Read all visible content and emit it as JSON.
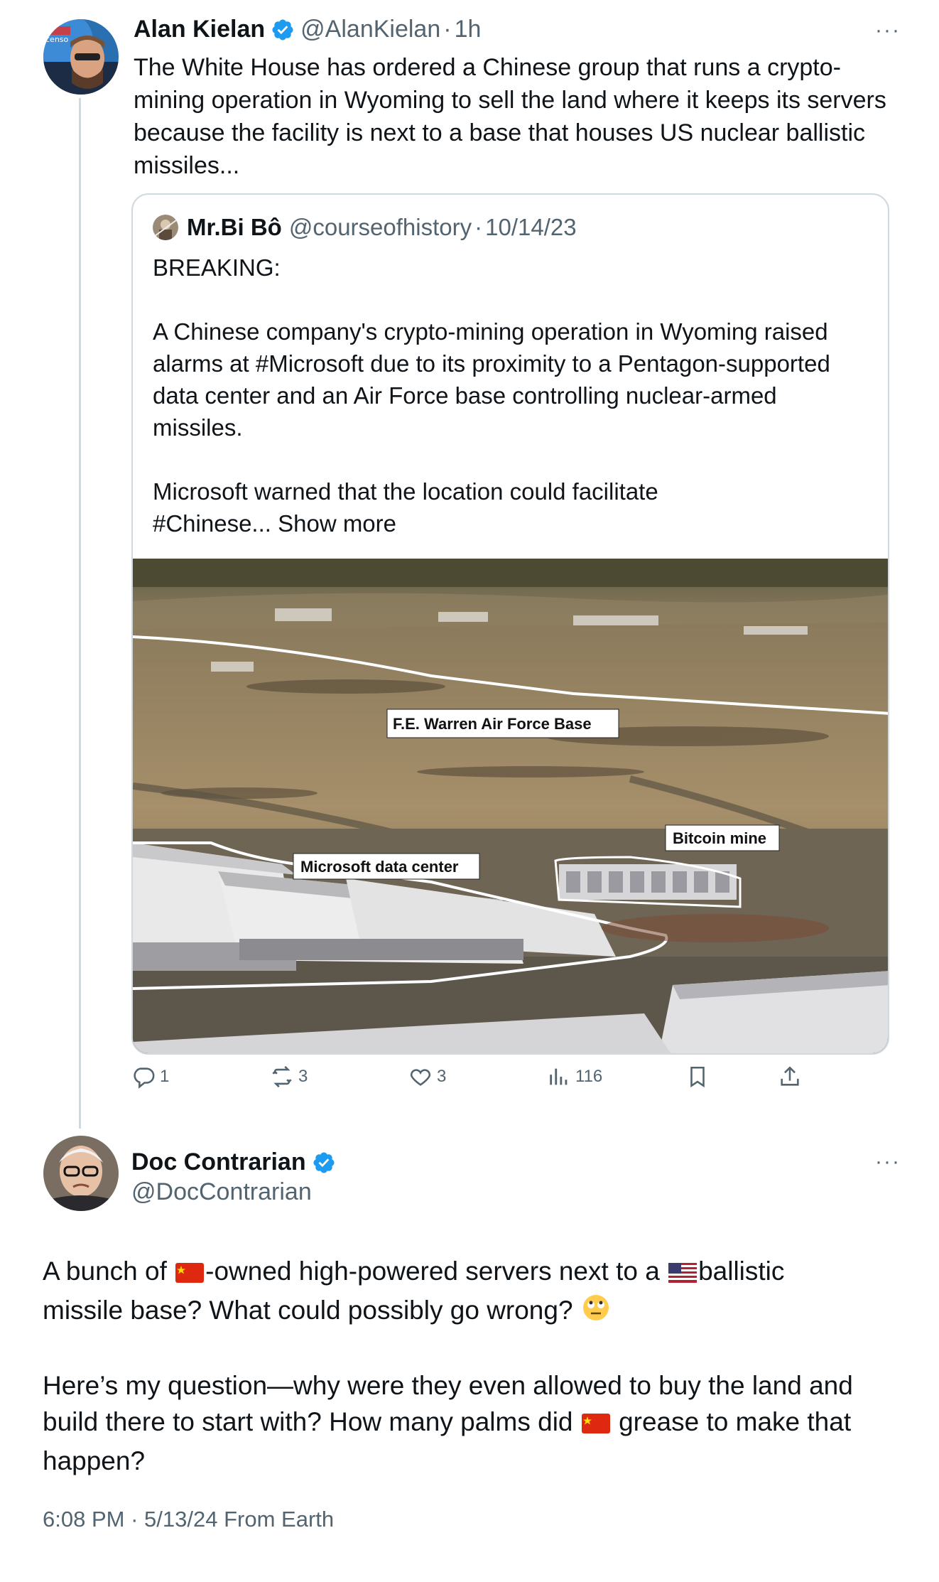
{
  "reply_parent": {
    "display_name": "Alan Kielan",
    "handle": "@AlanKielan",
    "separator": "·",
    "time": "1h",
    "text": "The White House has ordered a Chinese group that runs a crypto-\nmining operation in Wyoming to sell the land where it keeps its servers\nbecause the facility is next to a base that houses US nuclear ballistic\nmissiles...",
    "avatar_text": "censo"
  },
  "quote": {
    "display_name": "Mr.Bi Bô",
    "handle": "@courseofhistory",
    "separator": "·",
    "date": "10/14/23",
    "text": "BREAKING:\n\nA Chinese company's crypto-mining operation in Wyoming raised\nalarms at #Microsoft  due to its proximity to a Pentagon-supported\ndata center and an Air Force base controlling nuclear-armed\nmissiles.\n\nMicrosoft warned that the location could facilitate\n#Chinese...",
    "show_more": " Show more",
    "media_labels": {
      "air_force_base": "F.E. Warren Air Force Base",
      "bitcoin_mine": "Bitcoin mine",
      "data_center": "Microsoft data center"
    }
  },
  "actions": {
    "replies": "1",
    "reposts": "3",
    "likes": "3",
    "views": "116"
  },
  "main_post": {
    "display_name": "Doc Contrarian",
    "handle": "@DocContrarian",
    "text_1a": "A bunch of ",
    "text_1b": "-owned high-powered servers next to a ",
    "text_1c": "ballistic\nmissile base? What could possibly go wrong? ",
    "text_2a": "\n\nHere’s my question—why were they even allowed to buy the land and\nbuild there to start with? How many palms did ",
    "text_2b": " grease to make that\nhappen?",
    "time": "6:08 PM",
    "separator": "·",
    "date": "5/13/24",
    "source": "From Earth"
  },
  "icons": {
    "more": "more-horizontal-icon",
    "verified": "verified-badge-icon",
    "reply": "reply-icon",
    "repost": "repost-icon",
    "like": "heart-icon",
    "views": "views-chart-icon",
    "bookmark": "bookmark-icon",
    "share": "share-icon"
  },
  "colors": {
    "verified_blue": "#1d9bf0",
    "secondary_text": "#536471",
    "border": "#cfd9de"
  }
}
